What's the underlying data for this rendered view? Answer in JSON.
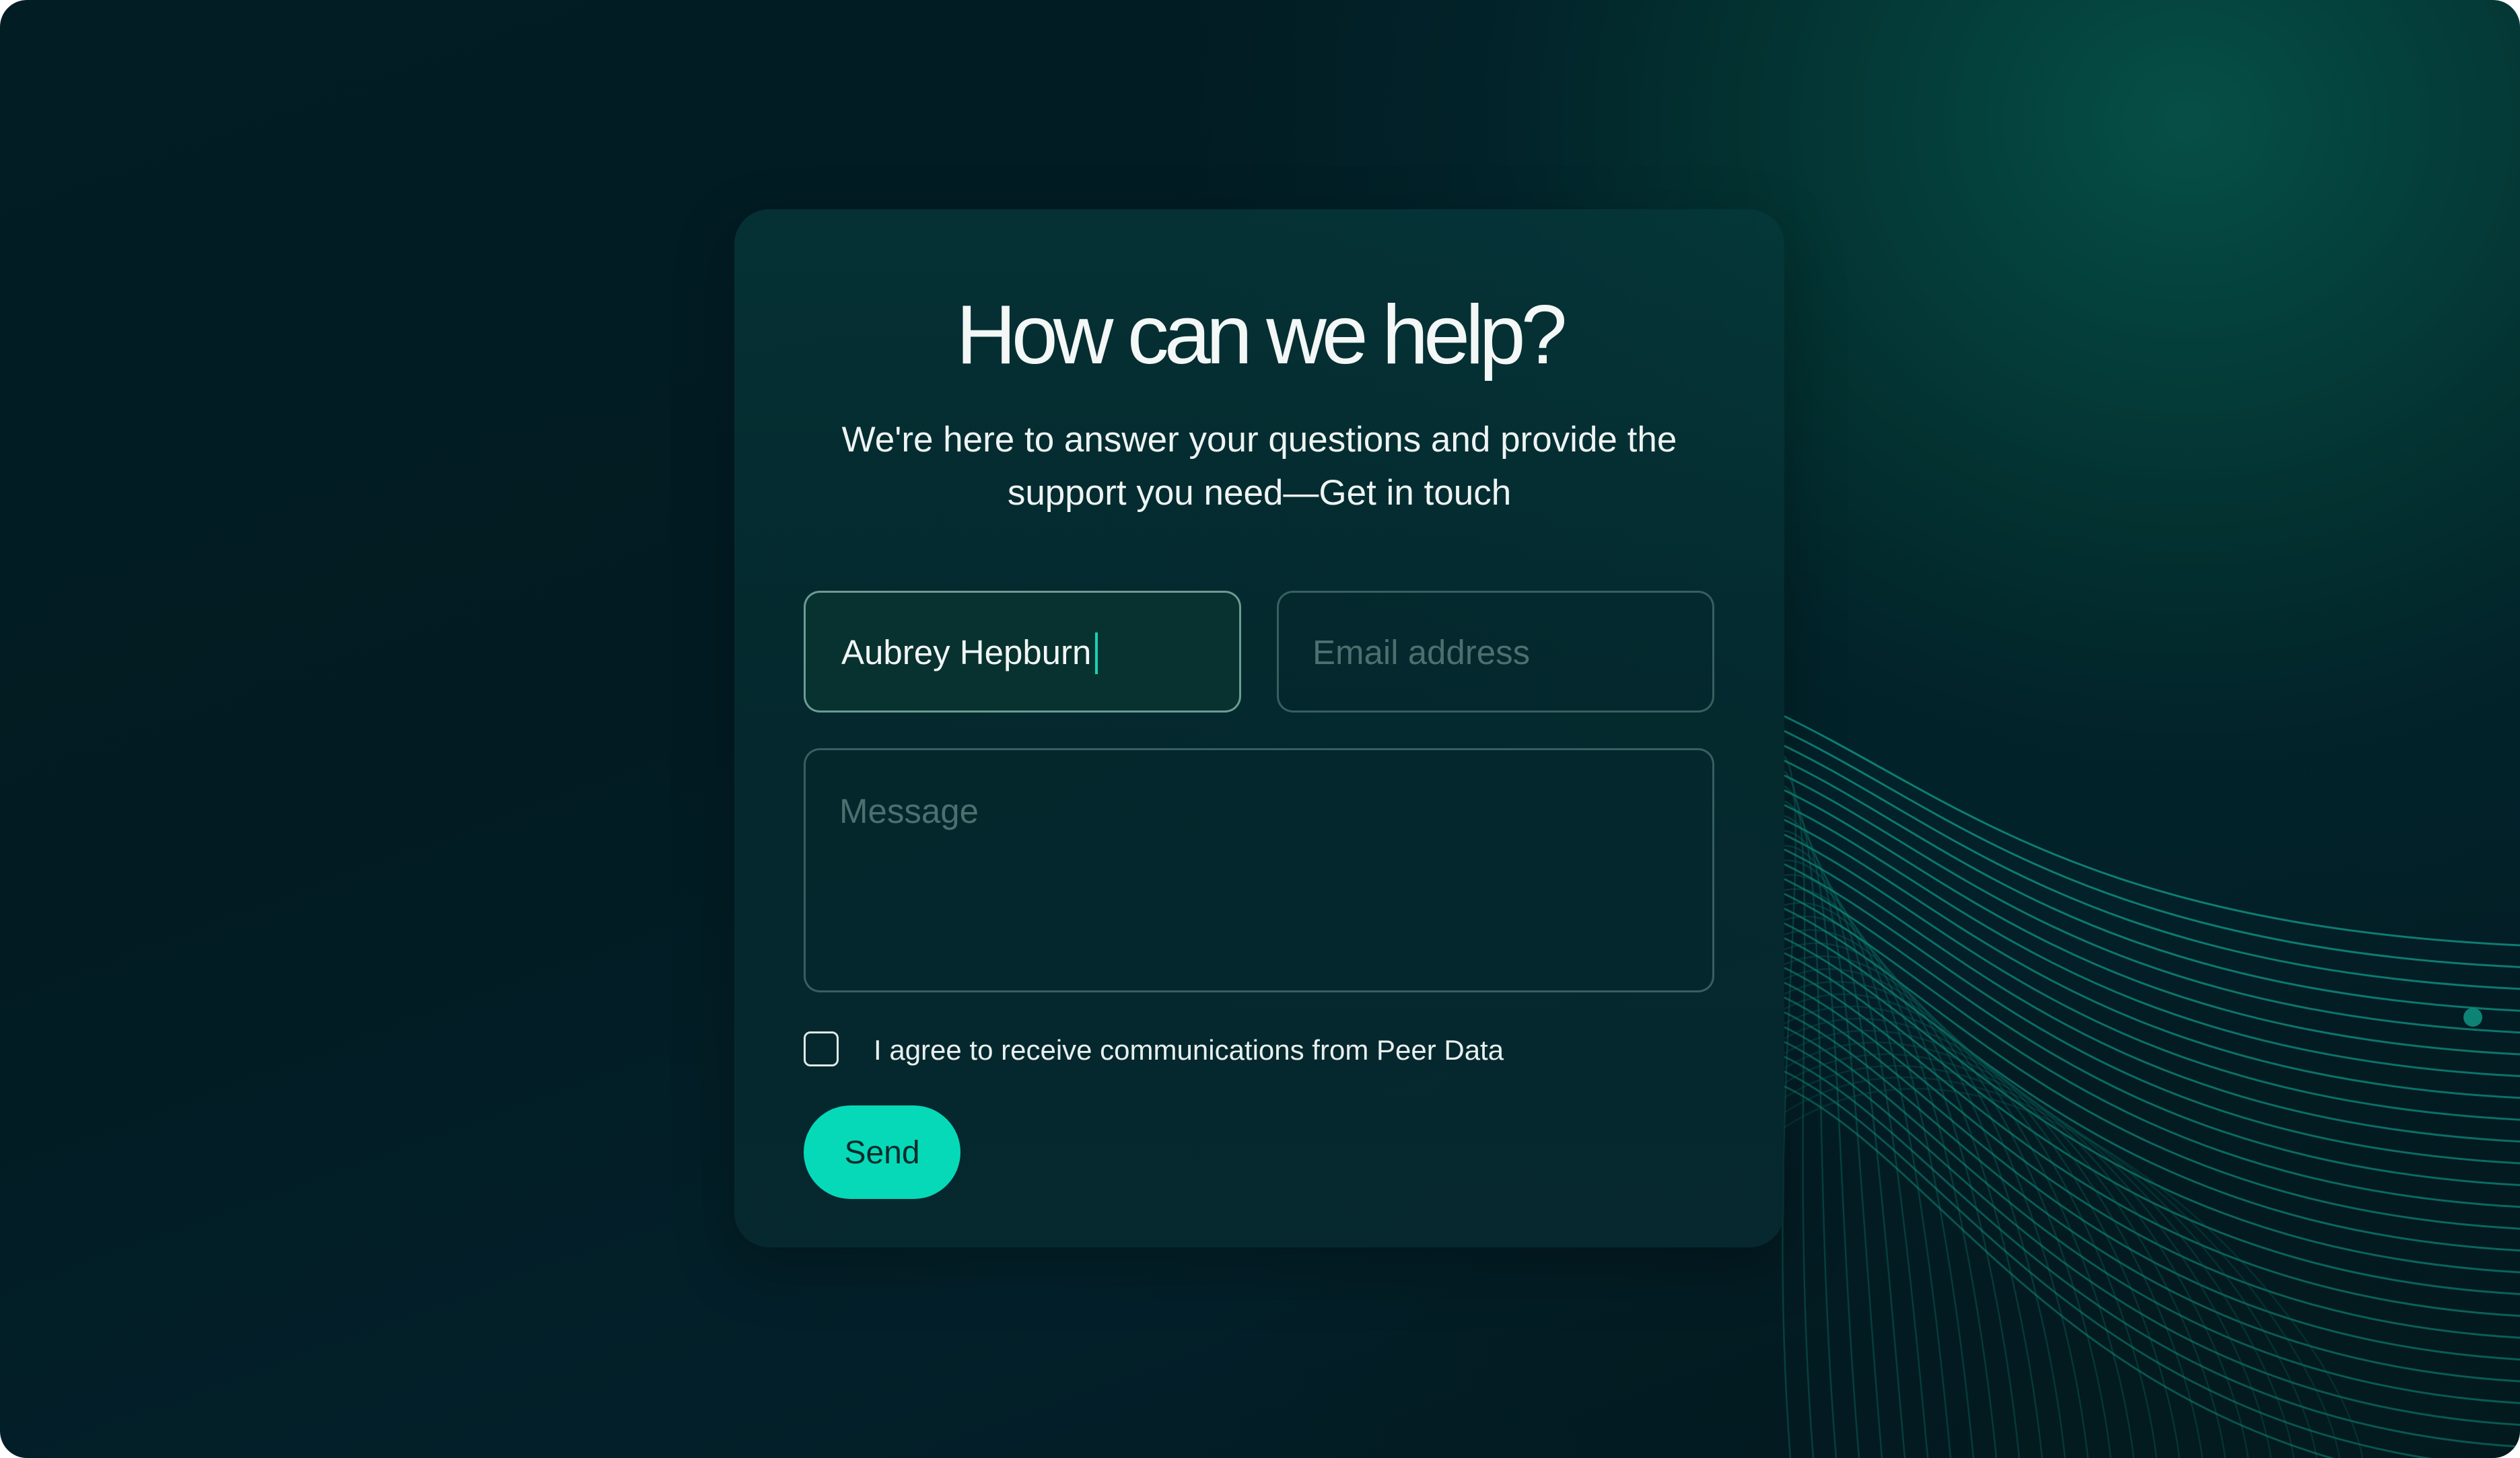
{
  "form": {
    "title": "How can we help?",
    "subtitle": "We're here to answer your questions and provide the support you need—Get in touch",
    "name_value": "Aubrey Hepburn",
    "email_placeholder": "Email address",
    "message_placeholder": "Message",
    "consent_label": "I agree to receive communications from Peer Data",
    "consent_checked": false,
    "send_label": "Send"
  },
  "colors": {
    "accent": "#06d9b8",
    "background": "#021d24",
    "card": "#05343a",
    "caret": "#19d2b0"
  }
}
